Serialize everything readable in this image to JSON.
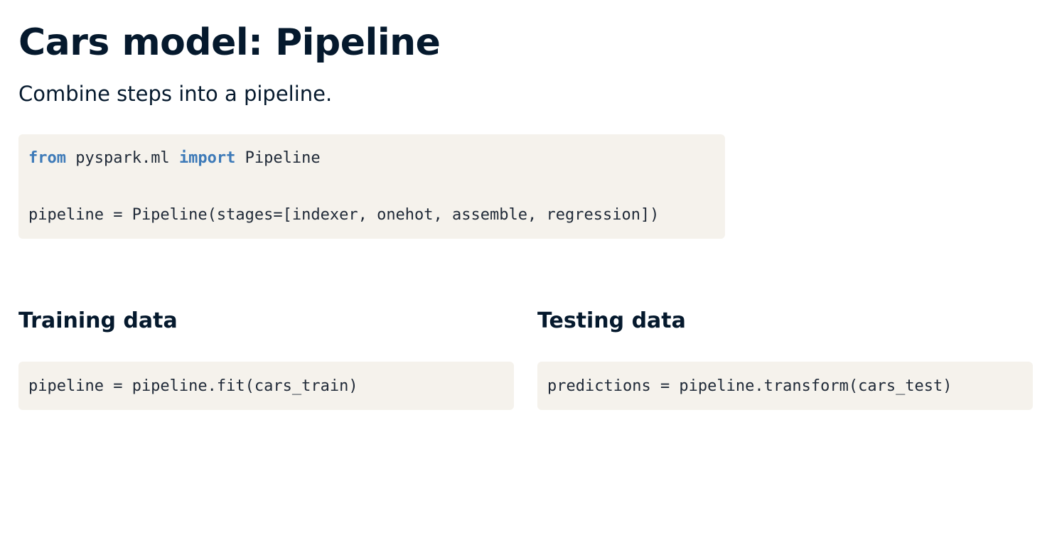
{
  "slide": {
    "title": "Cars model: Pipeline",
    "subtitle": "Combine steps into a pipeline."
  },
  "main_code": {
    "line1": {
      "kw_from": "from",
      "module": " pyspark.ml ",
      "kw_import": "import",
      "name": " Pipeline"
    },
    "line2": "pipeline = Pipeline(stages=[indexer, onehot, assemble, regression])"
  },
  "training": {
    "heading": "Training data",
    "code": "pipeline = pipeline.fit(cars_train)"
  },
  "testing": {
    "heading": "Testing data",
    "code": "predictions = pipeline.transform(cars_test)"
  },
  "colors": {
    "heading_text": "#05192d",
    "code_background": "#f5f2ec",
    "keyword": "#3d7ab8"
  }
}
